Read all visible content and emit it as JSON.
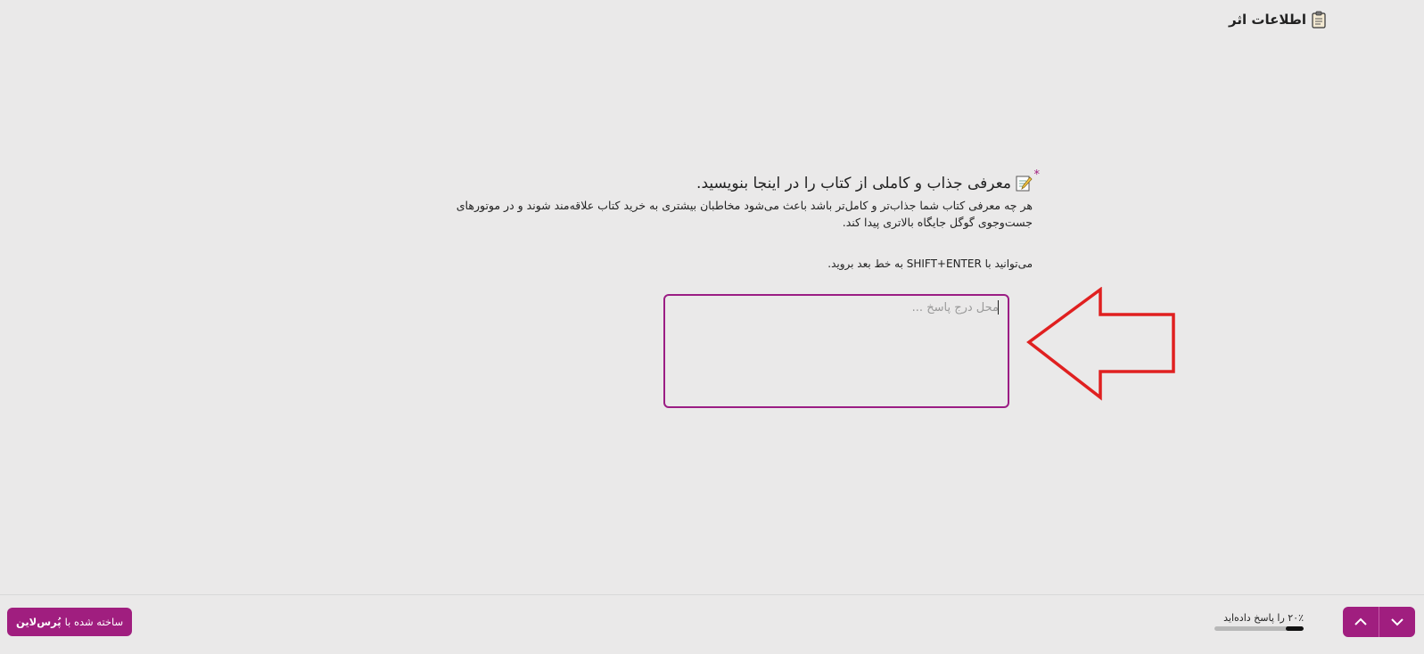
{
  "header": {
    "title": "اطلاعات اثر",
    "icon": "clipboard-icon"
  },
  "question": {
    "required_mark": "*",
    "icon": "memo-icon",
    "title": "معرفی جذاب و کاملی از کتاب را در اینجا بنویسید.",
    "description": "هر چه معرفی کتاب شما جذاب‌تر و کامل‌تر باشد باعث می‌شود مخاطبان بیشتری به خرید کتاب علاقه‌مند شوند و در موتورهای جست‌وجوی گوگل جایگاه بالاتری پیدا کند.",
    "hint": "می‌توانید با SHIFT+ENTER به خط بعد بروید."
  },
  "answer": {
    "value": "",
    "placeholder": "محل درج پاسخ ..."
  },
  "annotation": {
    "icon": "red-arrow-icon",
    "color": "#e02020"
  },
  "footer": {
    "brand_prefix": "ساخته شده با",
    "brand_name": "پُرس‌لاین",
    "progress_text": "۲۰٪ را پاسخ داده‌اید",
    "progress_value": 0.2,
    "next_icon": "chevron-down-icon",
    "prev_icon": "chevron-up-icon"
  },
  "colors": {
    "accent": "#a01e7f",
    "background": "#eae9e9"
  }
}
